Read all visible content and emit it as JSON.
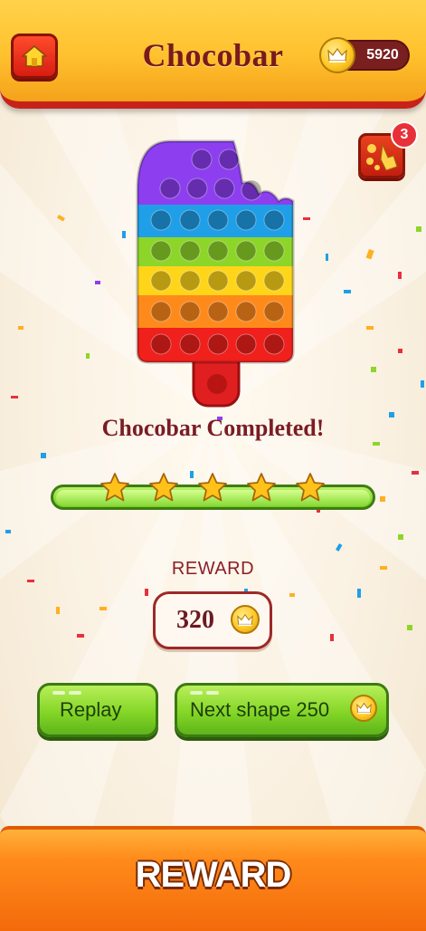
{
  "header": {
    "title": "Chocobar",
    "coins": "5920",
    "home_icon": "home-icon",
    "coin_icon": "crown-coin-icon"
  },
  "hint": {
    "badge_count": "3",
    "icon": "hint-tap-icon"
  },
  "result": {
    "completed_text": "Chocobar Completed!",
    "stars": 5,
    "stars_max": 5,
    "progress_fraction": 1.0
  },
  "reward": {
    "label": "REWARD",
    "amount": "320"
  },
  "buttons": {
    "replay_label": "Replay",
    "next_label": "Next shape 250"
  },
  "bottom_banner": {
    "label": "REWARD"
  },
  "colors": {
    "header": "#ffc12e",
    "header_border": "#c7221a",
    "title": "#7a1a1c",
    "button_green": "#84d627",
    "bottom_banner": "#f36a0b",
    "popsicle_rows": [
      "#8d3ff0",
      "#8d3ff0",
      "#1f9fe8",
      "#8ed52a",
      "#ffd51a",
      "#ff8a1c",
      "#f0201c"
    ]
  }
}
